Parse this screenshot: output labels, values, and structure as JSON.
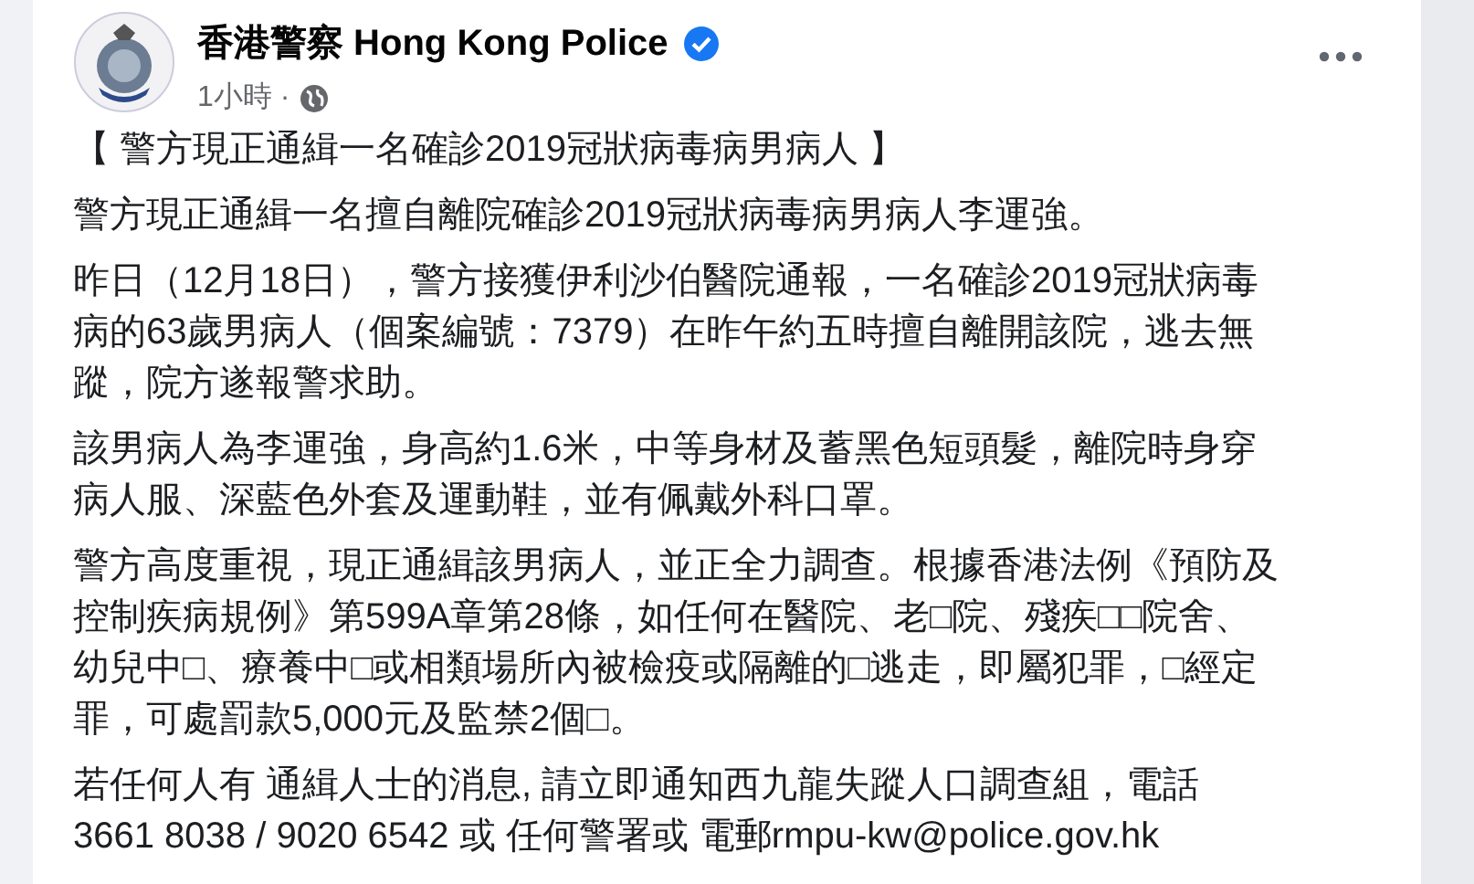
{
  "post": {
    "author": "香港警察 Hong Kong Police",
    "verified": true,
    "time": "1小時 ·",
    "title": "【 警方現正通緝一名確診2019冠狀病毒病男病人 】",
    "paragraphs": [
      "警方現正通緝一名擅自離院確診2019冠狀病毒病男病人李運強。",
      "昨日（12月18日），警方接獲伊利沙伯醫院通報，一名確診2019冠狀病毒病的63歲男病人（個案編號：7379）在昨午約五時擅自離開該院，逃去無蹤，院方遂報警求助。",
      "該男病人為李運強，身高約1.6米，中等身材及蓄黑色短頭髮，離院時身穿病人服、深藍色外套及運動鞋，並有佩戴外科口罩。",
      "警方高度重視，現正通緝該男病人，並正全力調查。根據香港法例《預防及控制疾病規例》第599A章第28條，如任何在醫院、老□院、殘疾□□院舍、幼兒中□、療養中□或相類場所內被檢疫或隔離的□逃走，即屬犯罪，□經定罪，可處罰款5,000元及監禁2個□。",
      "若任何人有 通緝人士的消息, 請立即通知西九龍失蹤人口調查組，電話 3661 8038 / 9020 6542 或 任何警署或 電郵rmpu-kw@police.gov.hk"
    ]
  }
}
